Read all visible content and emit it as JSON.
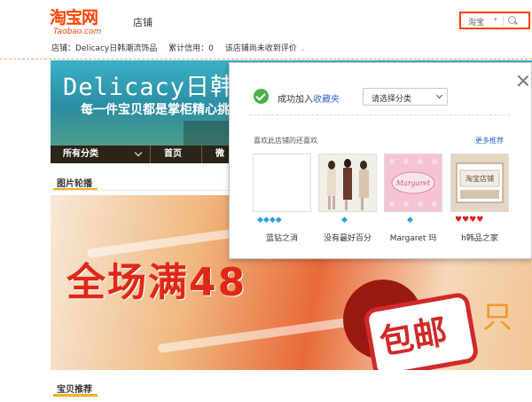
{
  "header": {
    "logo_cn": "淘宝网",
    "logo_en": "Taobao.com",
    "shop_tab": "店铺",
    "search_scope": "淘宝"
  },
  "shopbar": {
    "shop_label": "店铺：",
    "shop_name": "Delicacy日韩潮流饰品",
    "credit_label": "累计信用：",
    "credit_value": "0",
    "review_note": "该店铺尚未收到评价"
  },
  "banner": {
    "title": "Delicacy日韩",
    "slogan": "每一件宝贝都是掌柜精心挑"
  },
  "nav": {
    "items": [
      "所有分类",
      "首页",
      "微"
    ]
  },
  "sections": {
    "slideshow": "图片轮播",
    "recommend": "宝贝推荐"
  },
  "slide": {
    "headline": "全场满48",
    "badge": "包邮",
    "side_text": "只"
  },
  "popup": {
    "success_prefix": "成功加入",
    "success_link": "收藏夹",
    "category_select": "请选择分类",
    "also_liked": "喜欢此店铺的还喜欢",
    "more": "更多推荐",
    "shops": [
      {
        "name": "蓝钻之消",
        "rating": "◆◆◆◆",
        "rating_type": "diamond"
      },
      {
        "name": "没有最好百分",
        "rating": "◆",
        "rating_type": "diamond"
      },
      {
        "name": "Margaret 玛",
        "rating": "◆",
        "rating_type": "diamond"
      },
      {
        "name": "h韩品之家",
        "rating": "♥♥♥♥",
        "rating_type": "heart"
      }
    ],
    "thumb_texts": [
      "Margaret",
      "淘宝店铺"
    ]
  },
  "colors": {
    "brand": "#ff4400",
    "banner": "#2a8da3",
    "nav": "#2c2418",
    "link": "#3366cc",
    "success": "#4cae4c"
  }
}
